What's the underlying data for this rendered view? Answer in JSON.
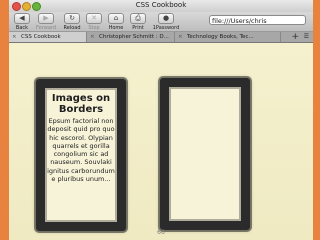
{
  "window": {
    "title": "CSS Cookbook"
  },
  "toolbar": {
    "buttons": [
      {
        "label": "Back",
        "icon": "◀"
      },
      {
        "label": "Forward",
        "icon": "▶"
      },
      {
        "label": "Reload",
        "icon": "↻"
      },
      {
        "label": "Stop",
        "icon": "✕"
      },
      {
        "label": "Home",
        "icon": "⌂"
      },
      {
        "label": "Print",
        "icon": "⎙"
      },
      {
        "label": "1Password",
        "icon": "●"
      }
    ],
    "address": "file:///Users/chris"
  },
  "tabs": [
    {
      "label": "CSS Cookbook"
    },
    {
      "label": "Christopher Schmitt : D..."
    },
    {
      "label": "Technology Books, Tec..."
    }
  ],
  "content": {
    "box_left": {
      "title": "Images on Borders",
      "body": "Epsum factorial non deposit quid pro quo hic escorol. Olypian quarrels et gorilla congolium sic ad nauseum. Souvlaki ignitus carborundum e pluribus unum..."
    },
    "page_number": "66"
  },
  "colors": {
    "frame": "#e8823f",
    "page_background": "#f3efc9",
    "border_ink": "#2b2b2b"
  }
}
